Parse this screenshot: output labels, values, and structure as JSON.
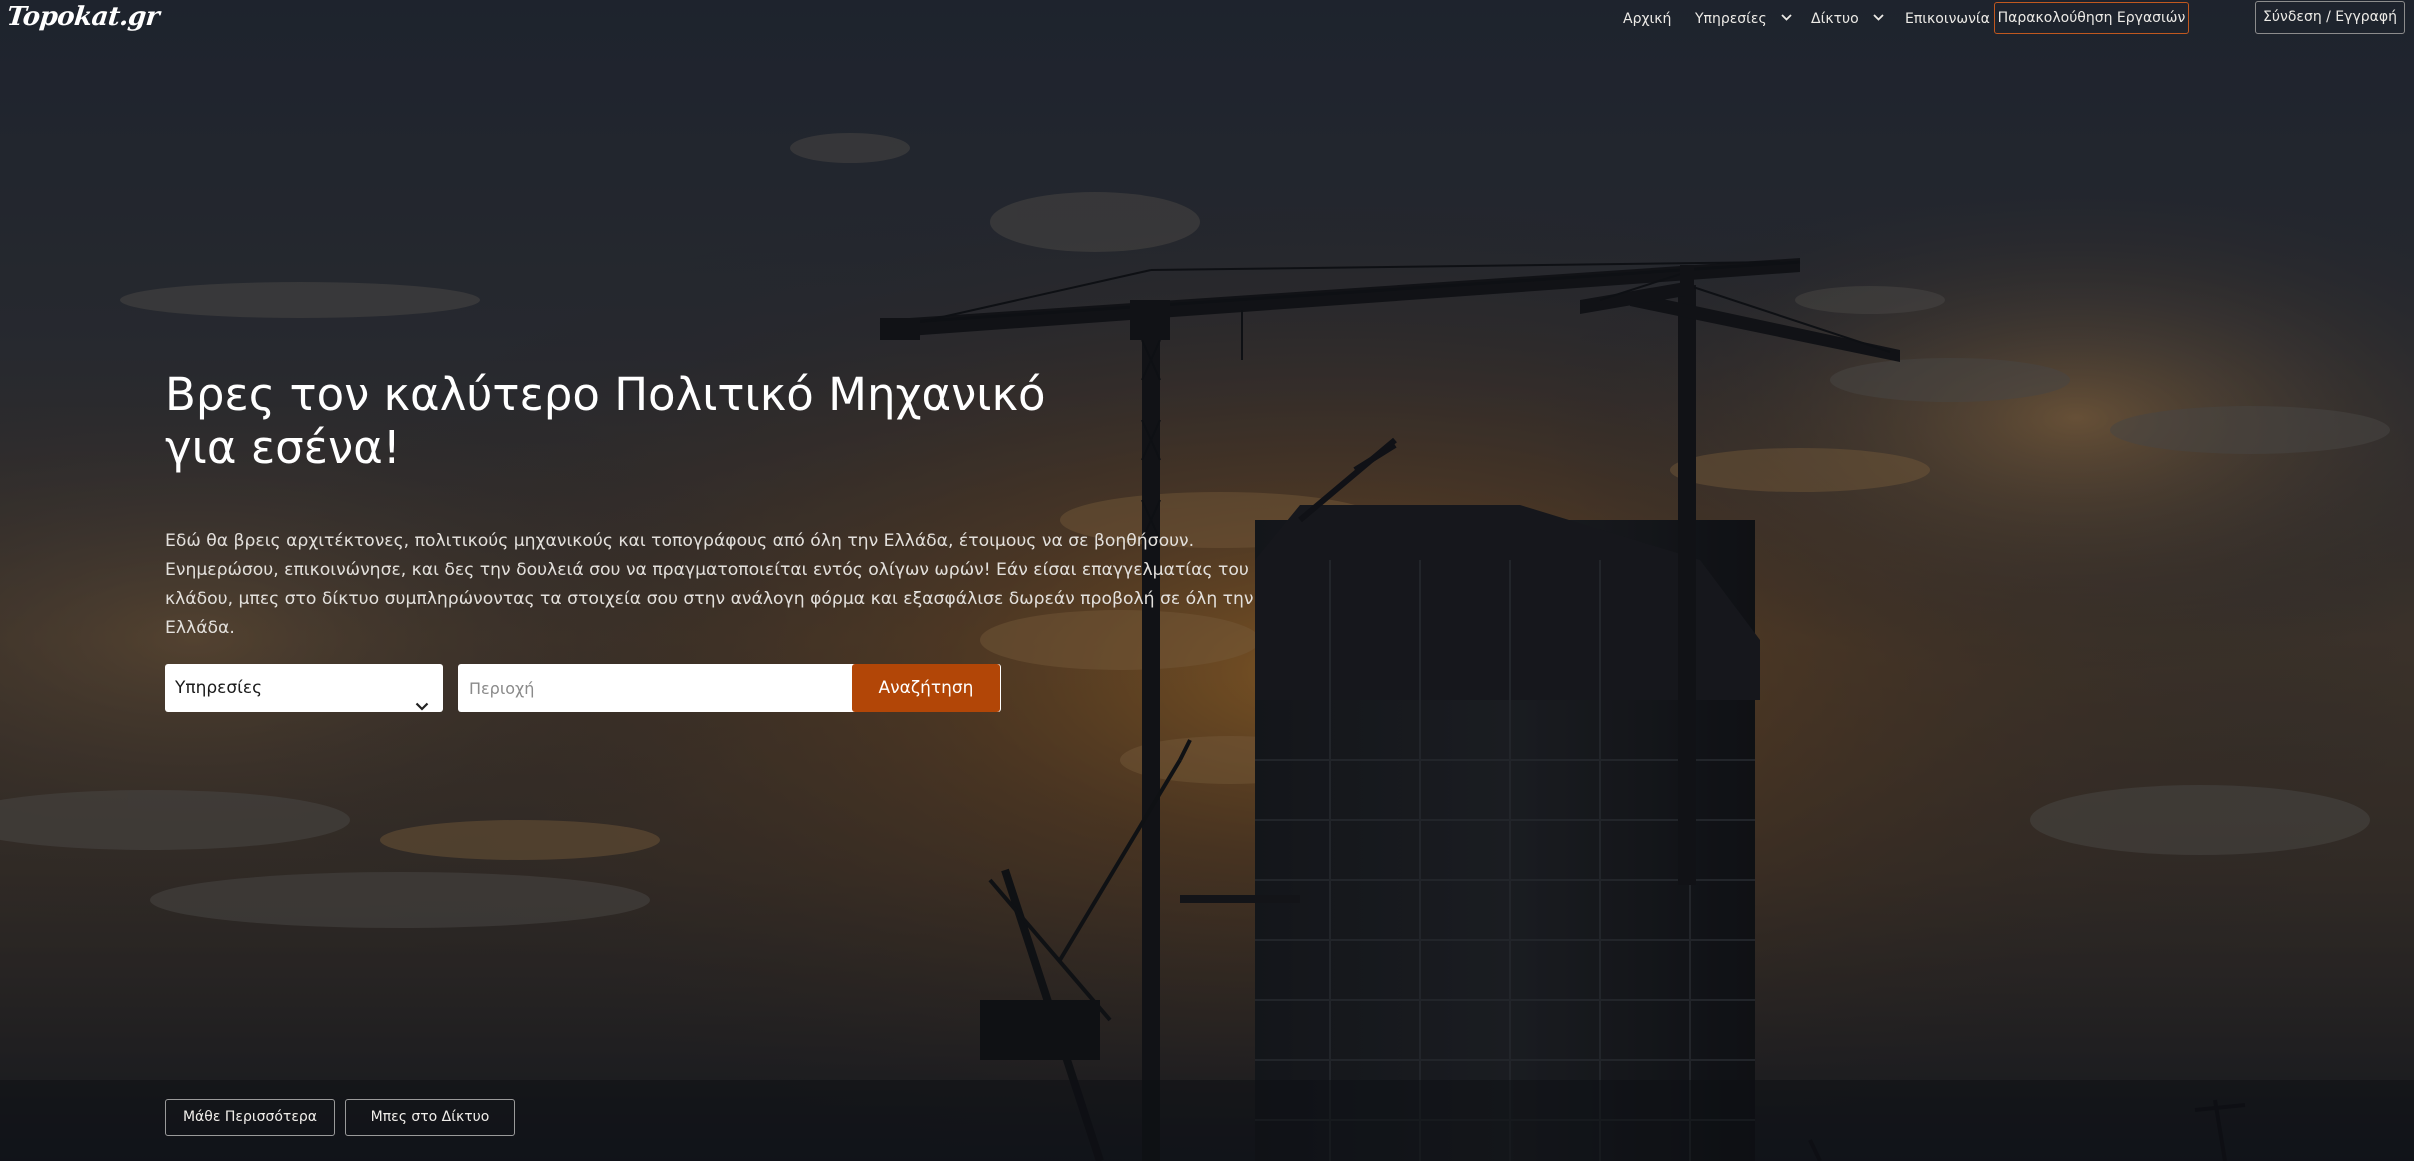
{
  "brand": {
    "logo_text": "Topokat.gr"
  },
  "nav": {
    "home": "Αρχική",
    "services": "Υπηρεσίες",
    "network": "Δίκτυο",
    "contact": "Επικοινωνία",
    "tracking": "Παρακολούθηση Εργασιών",
    "login": "Σύνδεση / Εγγραφή"
  },
  "hero": {
    "title_line1": "Βρες τον καλύτερο Πολιτικό Μηχανικό",
    "title_line2": "για εσένα!",
    "description": "Εδώ θα βρεις αρχιτέκτονες, πολιτικούς μηχανικούς και τοπογράφους από όλη την Ελλάδα, έτοιμους να σε βοηθήσουν. Ενημερώσου, επικοινώνησε, και δες την δουλειά σου να πραγματοποιείται εντός ολίγων ωρών! Εάν είσαι επαγγελματίας του κλάδου, μπες στο δίκτυο συμπληρώνοντας τα στοιχεία σου στην ανάλογη φόρμα και εξασφάλισε δωρεάν προβολή σε όλη την Ελλάδα."
  },
  "search": {
    "services_selected": "Υπηρεσίες",
    "area_placeholder": "Περιοχή",
    "area_value": "",
    "submit_label": "Αναζήτηση"
  },
  "actions": {
    "learn_more": "Μάθε Περισσότερα",
    "join_network": "Μπες στο Δίκτυο"
  },
  "colors": {
    "accent": "#b24607",
    "accent_border": "#c0581f"
  },
  "icons": {
    "dropdown": "chevron-down-icon"
  }
}
